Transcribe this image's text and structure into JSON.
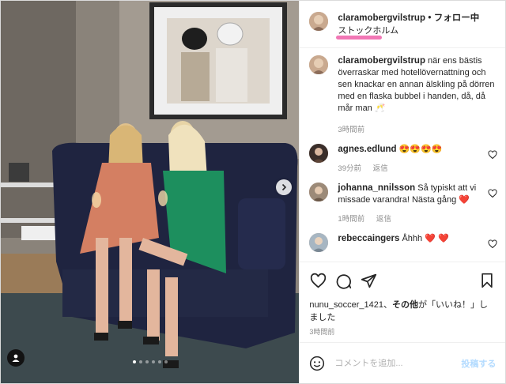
{
  "post": {
    "username": "claramobergvilstrup",
    "follow_separator": "•",
    "follow_label": "フォロー中",
    "location": "ストックホルム",
    "caption": "när ens bästis överraskar med hotellövernattning och sen knackar en annan älskling på dörren med en flaska bubbel i handen, då, då mår man 🥂",
    "caption_time": "3時間前"
  },
  "comments": [
    {
      "user": "agnes.edlund",
      "text": "😍😍😍😍",
      "time": "39分前",
      "reply": "返信"
    },
    {
      "user": "johanna_nnilsson",
      "text": "Så typiskt att vi missade varandra! Nästa gång ❤️",
      "time": "1時間前",
      "reply": "返信"
    },
    {
      "user": "rebeccaingers",
      "text": "Åhhh ❤️ ❤️",
      "time": "",
      "reply": ""
    }
  ],
  "likes": {
    "text_user": "nunu_soccer_1421",
    "text_mid": "、",
    "text_bold": "その他",
    "text_end": "が「いいね！」しました"
  },
  "post_time": "3時間前",
  "comment_box": {
    "placeholder": "コメントを追加...",
    "post_label": "投稿する"
  },
  "carousel": {
    "slides": 6,
    "active": 0
  },
  "icons": {
    "like": "heart-icon",
    "comment": "comment-icon",
    "share": "paper-plane-icon",
    "save": "bookmark-icon",
    "emoji": "emoji-icon",
    "next": "chevron-right-icon",
    "tag": "user-tag-icon"
  },
  "colors": {
    "location_highlight": "#ee5fa8",
    "post_button": "#b3dbff",
    "heart_red": "#ed4956"
  }
}
